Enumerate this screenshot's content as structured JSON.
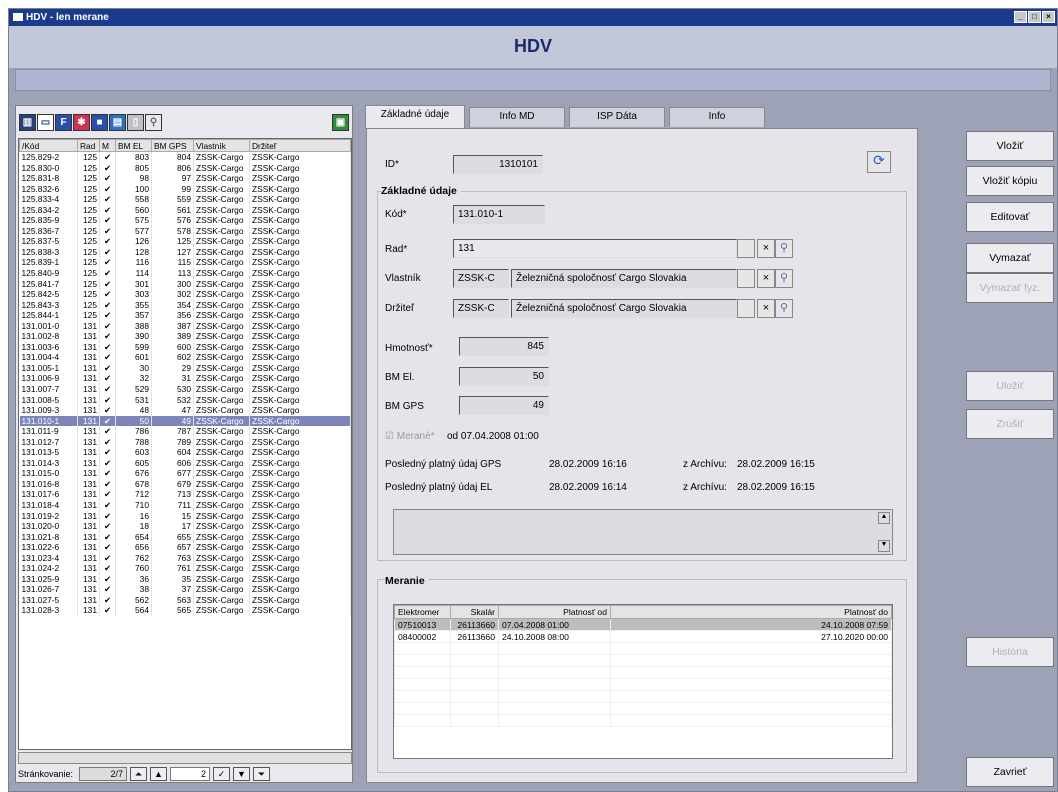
{
  "window": {
    "title": "HDV - len merane",
    "banner": "HDV"
  },
  "grid": {
    "columns": [
      "/Kód",
      "Rad",
      "M",
      "BM EL",
      "BM GPS",
      "Vlastník",
      "Držiteľ"
    ],
    "rows": [
      [
        "125.829-2",
        "125",
        "✔",
        "803",
        "804",
        "ZSSK-Cargo",
        "ZSSK-Cargo"
      ],
      [
        "125.830-0",
        "125",
        "✔",
        "805",
        "806",
        "ZSSK-Cargo",
        "ZSSK-Cargo"
      ],
      [
        "125.831-8",
        "125",
        "✔",
        "98",
        "97",
        "ZSSK-Cargo",
        "ZSSK-Cargo"
      ],
      [
        "125.832-6",
        "125",
        "✔",
        "100",
        "99",
        "ZSSK-Cargo",
        "ZSSK-Cargo"
      ],
      [
        "125.833-4",
        "125",
        "✔",
        "558",
        "559",
        "ZSSK-Cargo",
        "ZSSK-Cargo"
      ],
      [
        "125.834-2",
        "125",
        "✔",
        "560",
        "561",
        "ZSSK-Cargo",
        "ZSSK-Cargo"
      ],
      [
        "125.835-9",
        "125",
        "✔",
        "575",
        "576",
        "ZSSK-Cargo",
        "ZSSK-Cargo"
      ],
      [
        "125.836-7",
        "125",
        "✔",
        "577",
        "578",
        "ZSSK-Cargo",
        "ZSSK-Cargo"
      ],
      [
        "125.837-5",
        "125",
        "✔",
        "126",
        "125",
        "ZSSK-Cargo",
        "ZSSK-Cargo"
      ],
      [
        "125.838-3",
        "125",
        "✔",
        "128",
        "127",
        "ZSSK-Cargo",
        "ZSSK-Cargo"
      ],
      [
        "125.839-1",
        "125",
        "✔",
        "116",
        "115",
        "ZSSK-Cargo",
        "ZSSK-Cargo"
      ],
      [
        "125.840-9",
        "125",
        "✔",
        "114",
        "113",
        "ZSSK-Cargo",
        "ZSSK-Cargo"
      ],
      [
        "125.841-7",
        "125",
        "✔",
        "301",
        "300",
        "ZSSK-Cargo",
        "ZSSK-Cargo"
      ],
      [
        "125.842-5",
        "125",
        "✔",
        "303",
        "302",
        "ZSSK-Cargo",
        "ZSSK-Cargo"
      ],
      [
        "125.843-3",
        "125",
        "✔",
        "355",
        "354",
        "ZSSK-Cargo",
        "ZSSK-Cargo"
      ],
      [
        "125.844-1",
        "125",
        "✔",
        "357",
        "356",
        "ZSSK-Cargo",
        "ZSSK-Cargo"
      ],
      [
        "131.001-0",
        "131",
        "✔",
        "388",
        "387",
        "ZSSK-Cargo",
        "ZSSK-Cargo"
      ],
      [
        "131.002-8",
        "131",
        "✔",
        "390",
        "389",
        "ZSSK-Cargo",
        "ZSSK-Cargo"
      ],
      [
        "131.003-6",
        "131",
        "✔",
        "599",
        "600",
        "ZSSK-Cargo",
        "ZSSK-Cargo"
      ],
      [
        "131.004-4",
        "131",
        "✔",
        "601",
        "602",
        "ZSSK-Cargo",
        "ZSSK-Cargo"
      ],
      [
        "131.005-1",
        "131",
        "✔",
        "30",
        "29",
        "ZSSK-Cargo",
        "ZSSK-Cargo"
      ],
      [
        "131.006-9",
        "131",
        "✔",
        "32",
        "31",
        "ZSSK-Cargo",
        "ZSSK-Cargo"
      ],
      [
        "131.007-7",
        "131",
        "✔",
        "529",
        "530",
        "ZSSK-Cargo",
        "ZSSK-Cargo"
      ],
      [
        "131.008-5",
        "131",
        "✔",
        "531",
        "532",
        "ZSSK-Cargo",
        "ZSSK-Cargo"
      ],
      [
        "131.009-3",
        "131",
        "✔",
        "48",
        "47",
        "ZSSK-Cargo",
        "ZSSK-Cargo"
      ],
      [
        "131.010-1",
        "131",
        "✔",
        "50",
        "49",
        "ZSSK-Cargo",
        "ZSSK-Cargo"
      ],
      [
        "131.011-9",
        "131",
        "✔",
        "786",
        "787",
        "ZSSK-Cargo",
        "ZSSK-Cargo"
      ],
      [
        "131.012-7",
        "131",
        "✔",
        "788",
        "789",
        "ZSSK-Cargo",
        "ZSSK-Cargo"
      ],
      [
        "131.013-5",
        "131",
        "✔",
        "603",
        "604",
        "ZSSK-Cargo",
        "ZSSK-Cargo"
      ],
      [
        "131.014-3",
        "131",
        "✔",
        "605",
        "606",
        "ZSSK-Cargo",
        "ZSSK-Cargo"
      ],
      [
        "131.015-0",
        "131",
        "✔",
        "676",
        "677",
        "ZSSK-Cargo",
        "ZSSK-Cargo"
      ],
      [
        "131.016-8",
        "131",
        "✔",
        "678",
        "679",
        "ZSSK-Cargo",
        "ZSSK-Cargo"
      ],
      [
        "131.017-6",
        "131",
        "✔",
        "712",
        "713",
        "ZSSK-Cargo",
        "ZSSK-Cargo"
      ],
      [
        "131.018-4",
        "131",
        "✔",
        "710",
        "711",
        "ZSSK-Cargo",
        "ZSSK-Cargo"
      ],
      [
        "131.019-2",
        "131",
        "✔",
        "16",
        "15",
        "ZSSK-Cargo",
        "ZSSK-Cargo"
      ],
      [
        "131.020-0",
        "131",
        "✔",
        "18",
        "17",
        "ZSSK-Cargo",
        "ZSSK-Cargo"
      ],
      [
        "131.021-8",
        "131",
        "✔",
        "654",
        "655",
        "ZSSK-Cargo",
        "ZSSK-Cargo"
      ],
      [
        "131.022-6",
        "131",
        "✔",
        "656",
        "657",
        "ZSSK-Cargo",
        "ZSSK-Cargo"
      ],
      [
        "131.023-4",
        "131",
        "✔",
        "762",
        "763",
        "ZSSK-Cargo",
        "ZSSK-Cargo"
      ],
      [
        "131.024-2",
        "131",
        "✔",
        "760",
        "761",
        "ZSSK-Cargo",
        "ZSSK-Cargo"
      ],
      [
        "131.025-9",
        "131",
        "✔",
        "36",
        "35",
        "ZSSK-Cargo",
        "ZSSK-Cargo"
      ],
      [
        "131.026-7",
        "131",
        "✔",
        "38",
        "37",
        "ZSSK-Cargo",
        "ZSSK-Cargo"
      ],
      [
        "131.027-5",
        "131",
        "✔",
        "562",
        "563",
        "ZSSK-Cargo",
        "ZSSK-Cargo"
      ],
      [
        "131.028-3",
        "131",
        "✔",
        "564",
        "565",
        "ZSSK-Cargo",
        "ZSSK-Cargo"
      ]
    ],
    "selected_row": 25
  },
  "pager": {
    "label": "Stránkovanie:",
    "page": "2/7",
    "spin": "2"
  },
  "tabs": [
    "Základné údaje",
    "Info MD",
    "ISP Dáta",
    "Info"
  ],
  "form": {
    "id_label": "ID*",
    "id_value": "1310101",
    "group_title": "Základné údaje",
    "kod_label": "Kód*",
    "kod_value": "131.010-1",
    "rad_label": "Rad*",
    "rad_value": "131",
    "vlastnik_label": "Vlastník",
    "vlastnik_code": "ZSSK-C",
    "vlastnik_name": "Železničná spoločnosť Cargo Slovakia",
    "drzitel_label": "Držiteľ",
    "drzitel_code": "ZSSK-C",
    "drzitel_name": "Železničná spoločnosť Cargo Slovakia",
    "hmotnost_label": "Hmotnosť*",
    "hmotnost_value": "845",
    "bmel_label": "BM El.",
    "bmel_value": "50",
    "bmgps_label": "BM GPS",
    "bmgps_value": "49",
    "merane_label": "Merané*",
    "merane_od": "od  07.04.2008 01:00",
    "gps_label": "Posledný platný údaj GPS",
    "gps_value": "28.02.2009 16:16",
    "gps_arch_label": "z Archívu:",
    "gps_arch_value": "28.02.2009 16:15",
    "el_label": "Posledný platný údaj EL",
    "el_value": "28.02.2009 16:14",
    "el_arch_label": "z Archívu:",
    "el_arch_value": "28.02.2009 16:15"
  },
  "meranie": {
    "title": "Meranie",
    "columns": [
      "Elektromer",
      "Skalár",
      "Platnosť od",
      "Platnosť do"
    ],
    "rows": [
      [
        "07510013",
        "26113660",
        "07.04.2008 01:00",
        "24.10.2008 07:59"
      ],
      [
        "08400002",
        "26113660",
        "24.10.2008 08:00",
        "27.10.2020 00:00"
      ]
    ]
  },
  "buttons": {
    "vlozit": "Vložiť",
    "vlozit_kopiu": "Vložiť kópiu",
    "editovat": "Editovať",
    "vymazat": "Vymazať",
    "vymazat_fyz": "Vymazať fyz.",
    "ulozit": "Uložiť",
    "zrusit": "Zrušiť",
    "historia": "História",
    "zavriet": "Zavrieť"
  }
}
